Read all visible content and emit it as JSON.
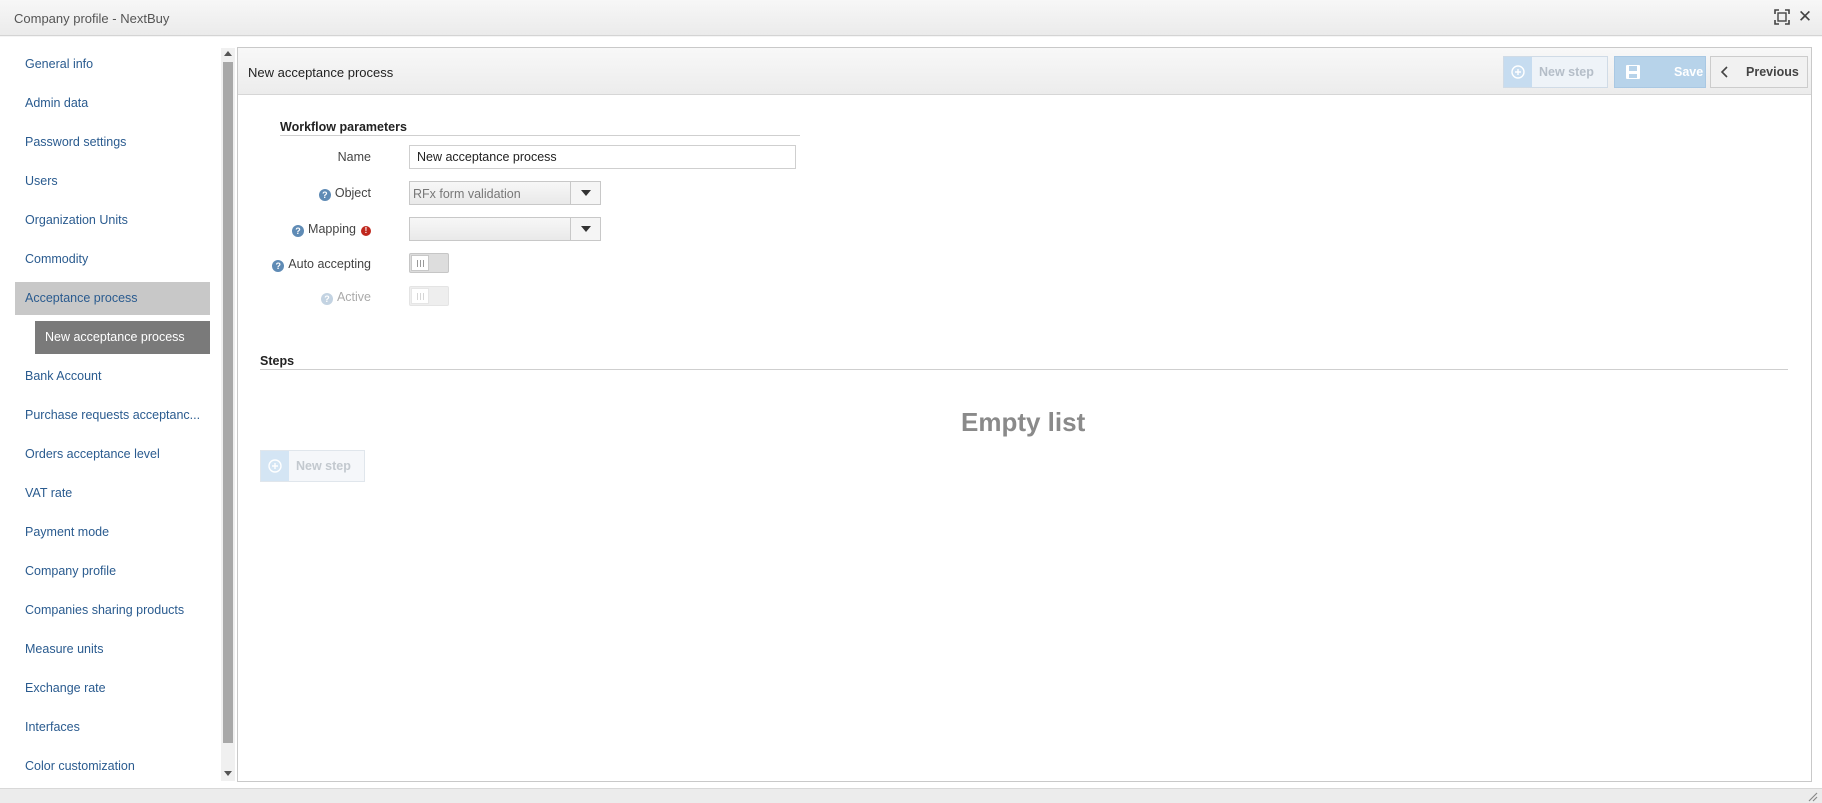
{
  "window": {
    "title": "Company profile - NextBuy",
    "close_glyph": "✕"
  },
  "sidebar": {
    "items": [
      {
        "label": "General info"
      },
      {
        "label": "Admin data"
      },
      {
        "label": "Password settings"
      },
      {
        "label": "Users"
      },
      {
        "label": "Organization Units"
      },
      {
        "label": "Commodity"
      },
      {
        "label": "Acceptance process",
        "active": true
      },
      {
        "label": "Bank Account"
      },
      {
        "label": "Purchase requests acceptanc..."
      },
      {
        "label": "Orders acceptance level"
      },
      {
        "label": "VAT rate"
      },
      {
        "label": "Payment mode"
      },
      {
        "label": "Company profile"
      },
      {
        "label": "Companies sharing products"
      },
      {
        "label": "Measure units"
      },
      {
        "label": "Exchange rate"
      },
      {
        "label": "Interfaces"
      },
      {
        "label": "Color customization"
      }
    ],
    "sub_item": {
      "label": "New acceptance process"
    }
  },
  "panel": {
    "title": "New acceptance process",
    "buttons": {
      "new_step": "New step",
      "save": "Save",
      "previous": "Previous"
    }
  },
  "workflow": {
    "section_title": "Workflow parameters",
    "name_label": "Name",
    "name_value": "New acceptance process",
    "object_label": "Object",
    "object_value": "RFx form validation",
    "mapping_label": "Mapping",
    "mapping_value": "",
    "auto_accepting_label": "Auto accepting",
    "auto_accepting_on": false,
    "active_label": "Active",
    "active_on": false
  },
  "steps": {
    "section_title": "Steps",
    "empty_text": "Empty list",
    "new_step_label": "New step"
  },
  "colors": {
    "link": "#2a5b8f",
    "active_item_bg": "#c8c8c8",
    "sub_item_bg": "#7a7a7a",
    "save_bg": "#b7d3ea",
    "help_icon": "#5f8bb5",
    "error_icon": "#c0281e"
  }
}
